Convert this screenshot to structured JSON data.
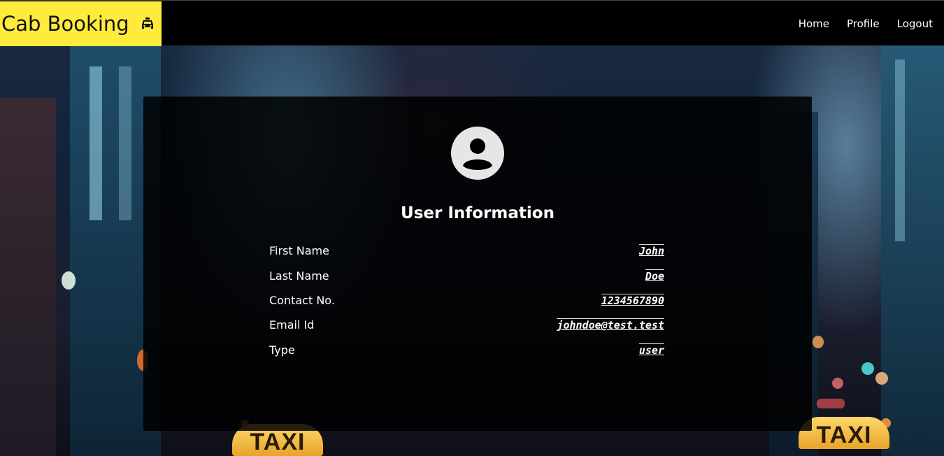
{
  "app": {
    "brand": "Cab Booking",
    "brand_icon": "taxi-icon",
    "brand_color": "#ffeb3b"
  },
  "nav": {
    "home": "Home",
    "profile": "Profile",
    "logout": "Logout"
  },
  "background": {
    "sign_left": "TAXI",
    "sign_right": "TAXI"
  },
  "profile": {
    "avatar_icon": "user-avatar-icon",
    "title": "User Information",
    "fields": [
      {
        "label": "First Name",
        "value": "John"
      },
      {
        "label": "Last Name",
        "value": "Doe"
      },
      {
        "label": "Contact No.",
        "value": "1234567890"
      },
      {
        "label": "Email Id",
        "value": "johndoe@test.test"
      },
      {
        "label": "Type",
        "value": "user"
      }
    ]
  }
}
